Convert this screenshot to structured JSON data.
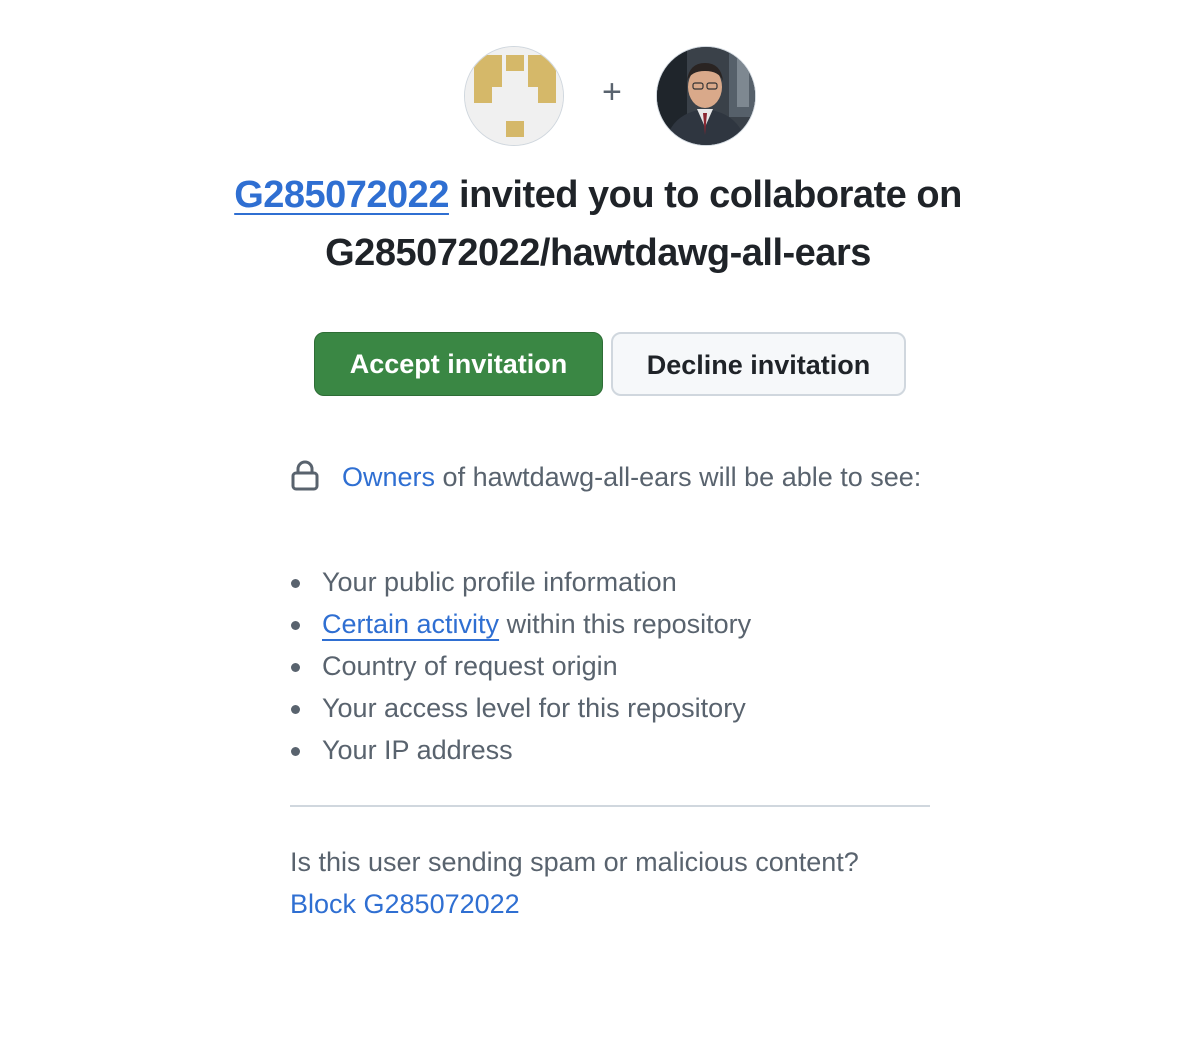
{
  "avatars": {
    "inviter_alt": "G285072022 avatar",
    "user_alt": "Your avatar",
    "separator": "+"
  },
  "heading": {
    "inviter": "G285072022",
    "text_after": "invited you to collaborate on",
    "repository": "G285072022/hawtdawg-all-ears"
  },
  "buttons": {
    "accept": "Accept invitation",
    "decline": "Decline invitation"
  },
  "privacy": {
    "icon": "lock-icon",
    "owners_link": "Owners",
    "text": "of hawtdawg-all-ears will be able to see:",
    "items": [
      {
        "text": "Your public profile information"
      },
      {
        "link": "Certain activity",
        "text": "within this repository"
      },
      {
        "text": "Country of request origin"
      },
      {
        "text": "Your access level for this repository"
      },
      {
        "text": "Your IP address"
      }
    ]
  },
  "spam": {
    "question": "Is this user sending spam or malicious content?",
    "block_link": "Block G285072022"
  },
  "colors": {
    "accept_bg": "#3a8744",
    "link": "#2f6fd2",
    "muted_text": "#59636e"
  }
}
